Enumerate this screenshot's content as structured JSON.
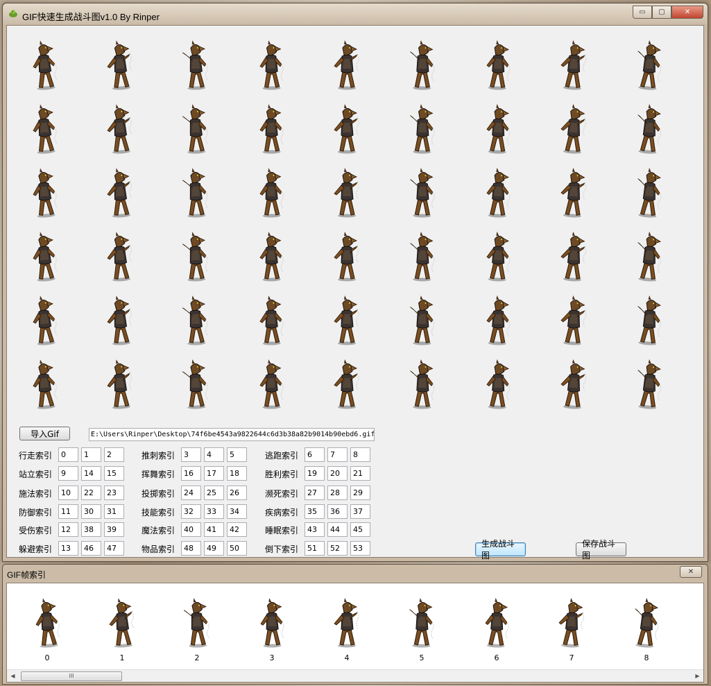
{
  "window": {
    "title": "GIF快速生成战斗图v1.0 By Rinper",
    "minimize_glyph": "▭",
    "maximize_glyph": "▢",
    "close_glyph": "✕",
    "icon": "app-green-figure-icon"
  },
  "sprite_grid": {
    "rows": 6,
    "cols": 9,
    "count": 54
  },
  "import_button": "导入Gif",
  "file_path": "E:\\Users\\Rinper\\Desktop\\74f6be4543a9822644c6d3b38a82b9014b90ebd6.gif",
  "index_groups": [
    [
      {
        "label": "行走索引",
        "values": [
          "0",
          "1",
          "2"
        ]
      },
      {
        "label": "站立索引",
        "values": [
          "9",
          "14",
          "15"
        ]
      },
      {
        "label": "施法索引",
        "values": [
          "10",
          "22",
          "23"
        ]
      },
      {
        "label": "防御索引",
        "values": [
          "11",
          "30",
          "31"
        ]
      },
      {
        "label": "受伤索引",
        "values": [
          "12",
          "38",
          "39"
        ]
      },
      {
        "label": "躲避索引",
        "values": [
          "13",
          "46",
          "47"
        ]
      }
    ],
    [
      {
        "label": "推刺索引",
        "values": [
          "3",
          "4",
          "5"
        ]
      },
      {
        "label": "挥舞索引",
        "values": [
          "16",
          "17",
          "18"
        ]
      },
      {
        "label": "投掷索引",
        "values": [
          "24",
          "25",
          "26"
        ]
      },
      {
        "label": "技能索引",
        "values": [
          "32",
          "33",
          "34"
        ]
      },
      {
        "label": "魔法索引",
        "values": [
          "40",
          "41",
          "42"
        ]
      },
      {
        "label": "物品索引",
        "values": [
          "48",
          "49",
          "50"
        ]
      }
    ],
    [
      {
        "label": "逃跑索引",
        "values": [
          "6",
          "7",
          "8"
        ]
      },
      {
        "label": "胜利索引",
        "values": [
          "19",
          "20",
          "21"
        ]
      },
      {
        "label": "濒死索引",
        "values": [
          "27",
          "28",
          "29"
        ]
      },
      {
        "label": "疾病索引",
        "values": [
          "35",
          "36",
          "37"
        ]
      },
      {
        "label": "睡眠索引",
        "values": [
          "43",
          "44",
          "45"
        ]
      },
      {
        "label": "倒下索引",
        "values": [
          "51",
          "52",
          "53"
        ]
      }
    ]
  ],
  "generate_button": "生成战斗图",
  "save_button": "保存战斗图",
  "frame_panel": {
    "title": "GIF帧索引",
    "close_glyph": "✕",
    "frames": [
      "0",
      "1",
      "2",
      "3",
      "4",
      "5",
      "6",
      "7",
      "8"
    ],
    "scroll_left_glyph": "◀",
    "scroll_right_glyph": "▶",
    "scroll_thumb_grip": "III"
  }
}
